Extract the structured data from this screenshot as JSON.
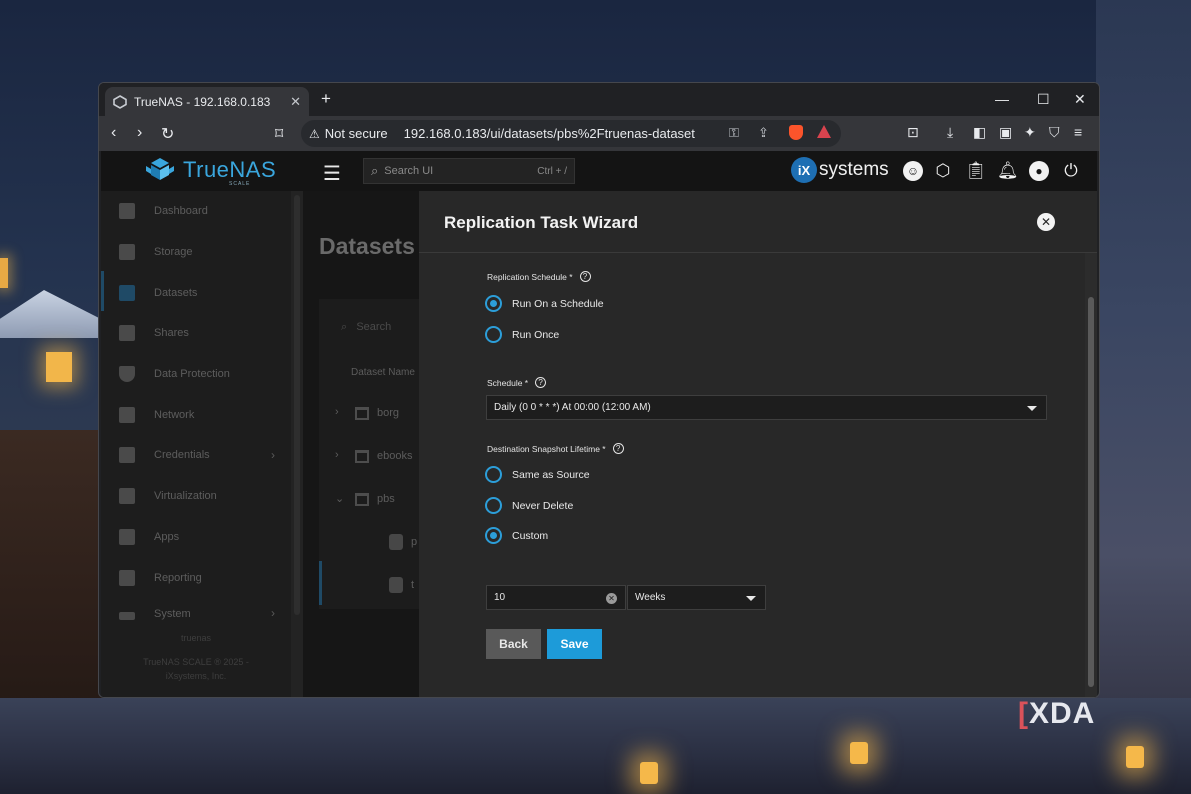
{
  "browser": {
    "tab_title": "TrueNAS - 192.168.0.183",
    "security_label": "Not secure",
    "url": "192.168.0.183/ui/datasets/pbs%2Ftruenas-dataset"
  },
  "app": {
    "logo_text": "TrueNAS",
    "logo_sub": "SCALE",
    "search_placeholder": "Search UI",
    "search_shortcut": "Ctrl + /",
    "vendor_ix": "iX",
    "vendor_systems": "systems"
  },
  "sidebar": {
    "items": [
      {
        "label": "Dashboard",
        "icon": "dashboard-icon"
      },
      {
        "label": "Storage",
        "icon": "storage-icon"
      },
      {
        "label": "Datasets",
        "icon": "datasets-icon"
      },
      {
        "label": "Shares",
        "icon": "shares-icon"
      },
      {
        "label": "Data Protection",
        "icon": "shield-icon"
      },
      {
        "label": "Network",
        "icon": "network-icon"
      },
      {
        "label": "Credentials",
        "icon": "key-icon"
      },
      {
        "label": "Virtualization",
        "icon": "monitor-icon"
      },
      {
        "label": "Apps",
        "icon": "apps-icon"
      },
      {
        "label": "Reporting",
        "icon": "chart-icon"
      },
      {
        "label": "System",
        "icon": "gear-icon"
      }
    ],
    "footer_host": "truenas",
    "footer_copyright": "TrueNAS SCALE ® 2025 -",
    "footer_company": "iXsystems, Inc."
  },
  "datasets_page": {
    "title": "Datasets",
    "search_placeholder": "Search",
    "column_header": "Dataset Name",
    "rows": [
      {
        "name": "borg",
        "expander": "›"
      },
      {
        "name": "ebooks",
        "expander": "›"
      },
      {
        "name": "pbs",
        "expander": "⌄"
      },
      {
        "name": "p"
      },
      {
        "name": "t"
      }
    ]
  },
  "modal": {
    "title": "Replication Task Wizard",
    "replication_schedule_label": "Replication Schedule *",
    "run_on_schedule": "Run On a Schedule",
    "run_once": "Run Once",
    "schedule_label": "Schedule *",
    "schedule_value": "Daily (0 0 * * *)  At 00:00 (12:00 AM)",
    "lifetime_label": "Destination Snapshot Lifetime *",
    "same_as_source": "Same as Source",
    "never_delete": "Never Delete",
    "custom": "Custom",
    "lifetime_value": "10",
    "lifetime_unit": "Weeks",
    "back_label": "Back",
    "save_label": "Save"
  },
  "watermark": "XDA",
  "colors": {
    "accent": "#1d9bd9",
    "radio": "#2c9ed9",
    "logo": "#3aa6dd"
  }
}
